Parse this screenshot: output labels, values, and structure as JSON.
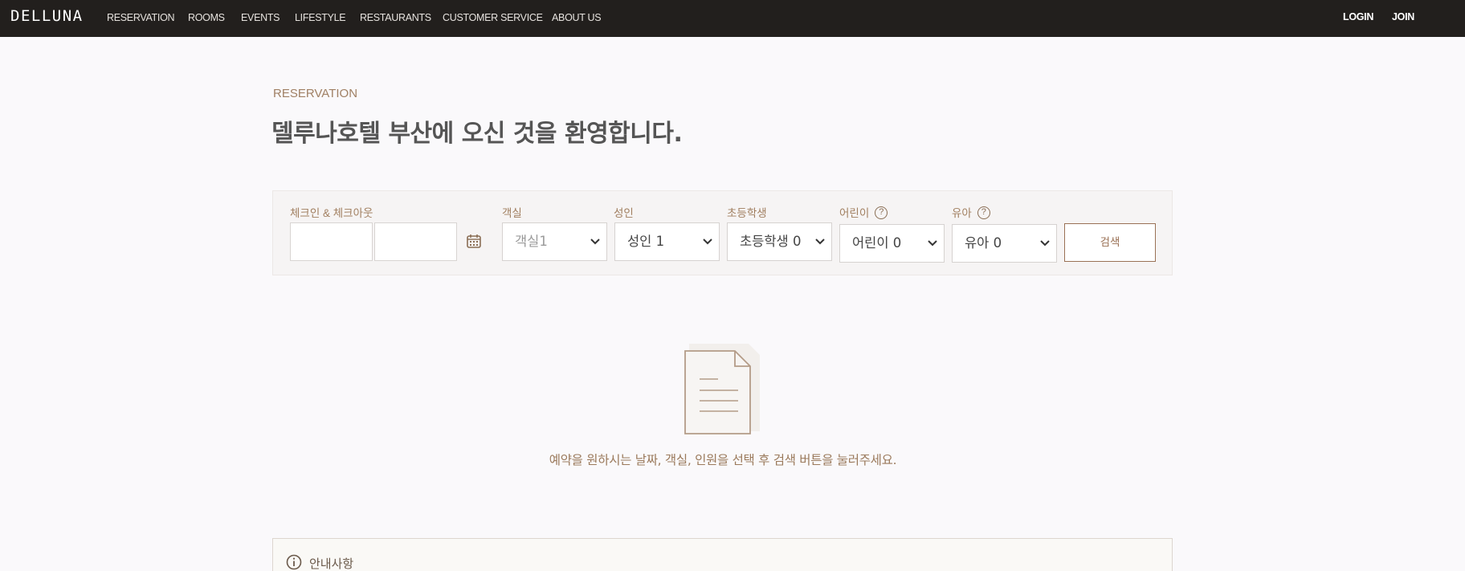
{
  "nav": {
    "logo": "DELLUNA",
    "items": [
      "RESERVATION",
      "ROOMS",
      "EVENTS",
      "LIFESTYLE",
      "RESTAURANTS",
      "CUSTOMER SERVICE",
      "ABOUT US"
    ],
    "login": "LOGIN",
    "join": "JOIN"
  },
  "hero": {
    "eyebrow": "RESERVATION",
    "title": "델루나호텔 부산에 오신 것을 환영합니다."
  },
  "search": {
    "checkin_label": "체크인 & 체크아웃",
    "checkin_value": "",
    "checkout_value": "",
    "rooms": {
      "label": "객실",
      "value": "객실1"
    },
    "adults": {
      "label": "성인",
      "value": "성인 1"
    },
    "elementary": {
      "label": "초등학생",
      "value": "초등학생 0"
    },
    "children": {
      "label": "어린이",
      "value": "어린이 0",
      "help": "?"
    },
    "infants": {
      "label": "유아",
      "value": "유아 0",
      "help": "?"
    },
    "button": "검색"
  },
  "empty_state": {
    "message": "예약을 원하시는 날짜, 객실, 인원을 선택 후 검색 버튼을 눌러주세요."
  },
  "notice": {
    "title": "안내사항"
  },
  "colors": {
    "nav_bg": "#221f1d",
    "accent": "#9a7155",
    "page_bg": "#faf9fb"
  }
}
